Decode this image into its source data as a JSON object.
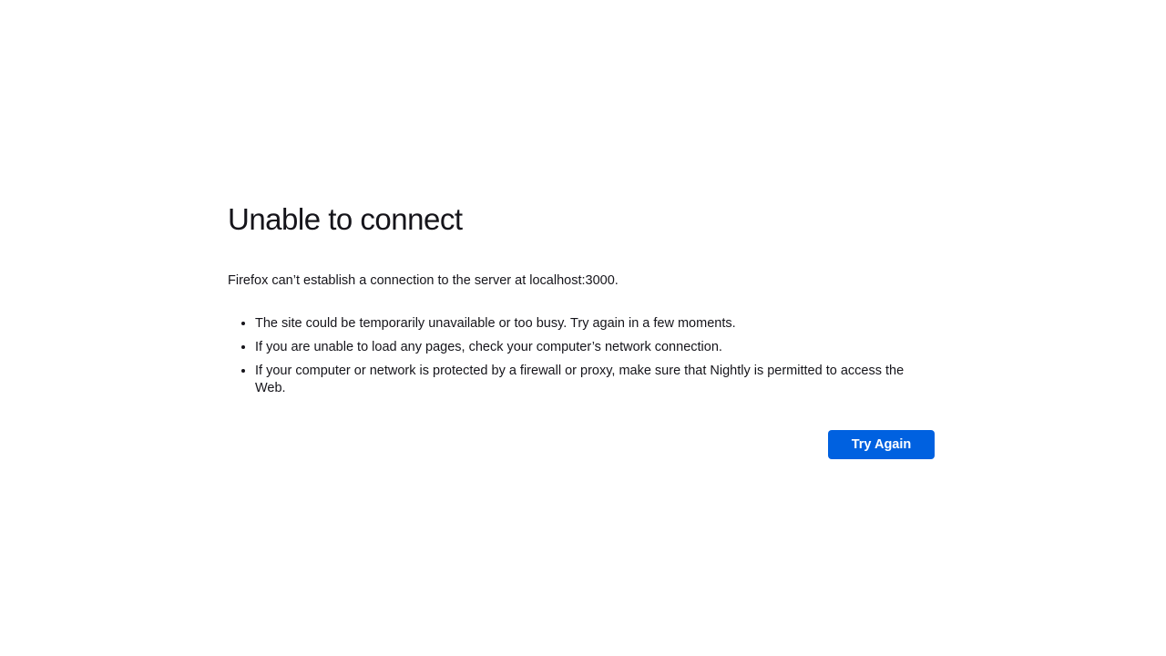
{
  "error": {
    "title": "Unable to connect",
    "description": "Firefox can’t establish a connection to the server at localhost:3000.",
    "reasons": [
      "The site could be temporarily unavailable or too busy. Try again in a few moments.",
      "If you are unable to load any pages, check your computer’s network connection.",
      "If your computer or network is protected by a firewall or proxy, make sure that Nightly is permitted to access the Web."
    ],
    "try_again_label": "Try Again"
  },
  "colors": {
    "background": "#ffffff",
    "text": "#15141a",
    "primary_button": "#0061e0",
    "primary_button_text": "#ffffff"
  }
}
